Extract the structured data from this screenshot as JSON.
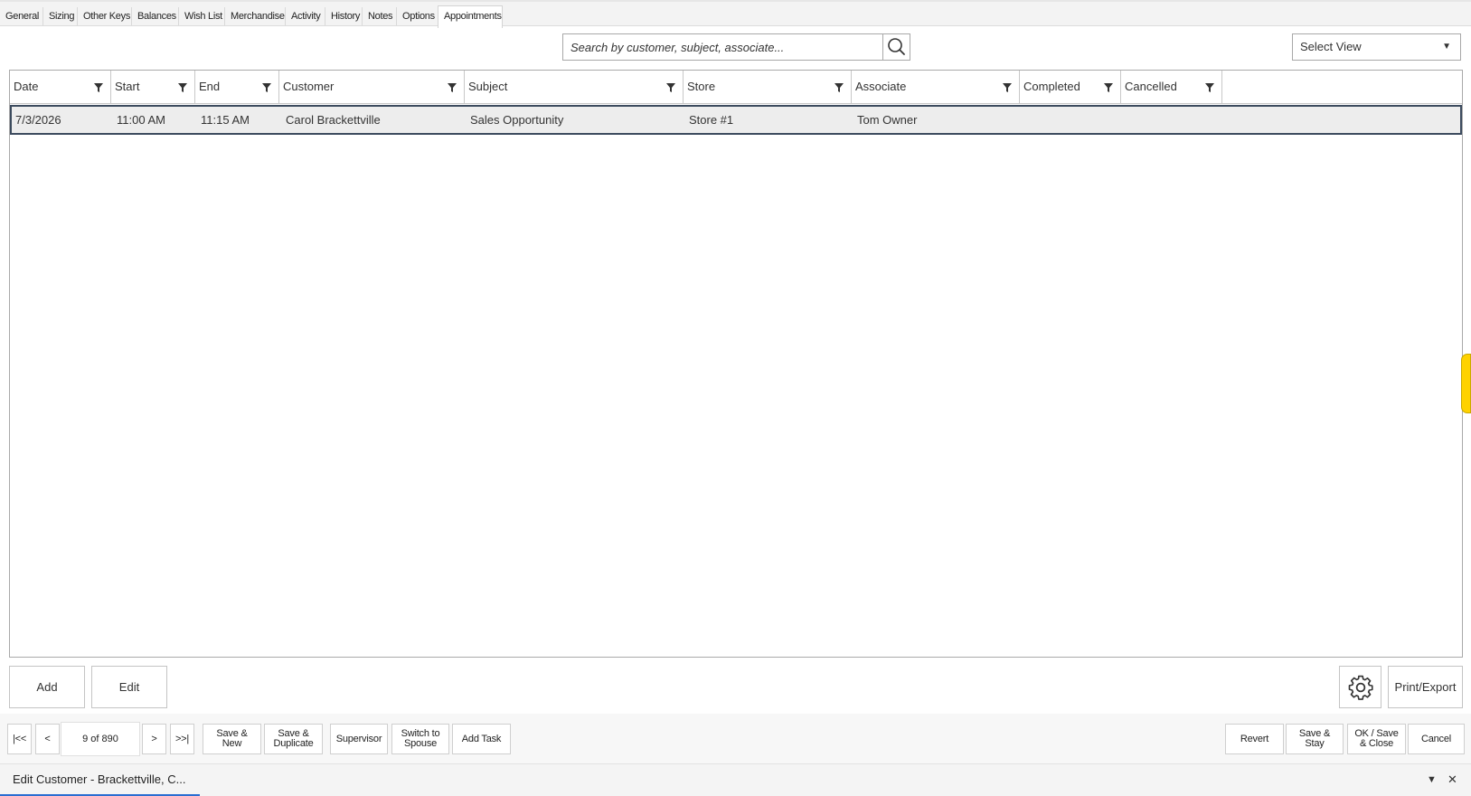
{
  "tabs": [
    "General",
    "Sizing",
    "Other Keys",
    "Balances",
    "Wish List",
    "Merchandise",
    "Activity",
    "History",
    "Notes",
    "Options",
    "Appointments"
  ],
  "search": {
    "placeholder": "Search by customer, subject, associate..."
  },
  "select_view": {
    "label": "Select View"
  },
  "grid": {
    "columns": [
      "Date",
      "Start",
      "End",
      "Customer",
      "Subject",
      "Store",
      "Associate",
      "Completed",
      "Cancelled"
    ],
    "rows": [
      {
        "date": "7/3/2026",
        "start": "11:00 AM",
        "end": "11:15 AM",
        "customer": "Carol Brackettville",
        "subject": "Sales Opportunity",
        "store": "Store #1",
        "associate": "Tom Owner",
        "completed": "",
        "cancelled": ""
      }
    ]
  },
  "actions": {
    "add": "Add",
    "edit": "Edit",
    "print_export": "Print/Export"
  },
  "pager": {
    "first": "|<<",
    "prev": "<",
    "count": "9 of 890",
    "next": ">",
    "last": ">>|"
  },
  "toolbar": {
    "save_new": "Save &\nNew",
    "save_duplicate": "Save &\nDuplicate",
    "supervisor": "Supervisor",
    "switch_spouse": "Switch to\nSpouse",
    "add_task": "Add Task",
    "revert": "Revert",
    "save_stay": "Save &\nStay",
    "ok_save_close": "OK / Save\n& Close",
    "cancel": "Cancel"
  },
  "status": {
    "title": "Edit Customer - Brackettville, C..."
  },
  "colors": {
    "selected_border": "#3c4b5e",
    "selected_fill": "#ededed",
    "accent": "#2a6ed1",
    "help_tab": "#ffd200"
  }
}
